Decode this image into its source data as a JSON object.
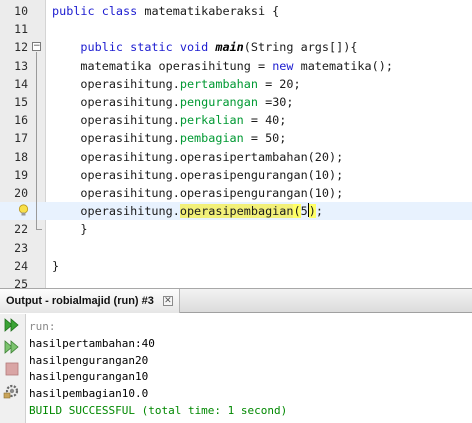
{
  "editor": {
    "lines": [
      {
        "num": "10",
        "tokens": [
          {
            "t": "public class ",
            "c": "kw"
          },
          {
            "t": "matematikaberaksi {",
            "c": ""
          }
        ]
      },
      {
        "num": "11",
        "tokens": []
      },
      {
        "num": "12",
        "tokens": [
          {
            "t": "    public static void ",
            "c": "kw"
          },
          {
            "t": "main",
            "c": "mth"
          },
          {
            "t": "(String args[]){",
            "c": ""
          }
        ]
      },
      {
        "num": "13",
        "tokens": [
          {
            "t": "    matematika operasihitung = ",
            "c": ""
          },
          {
            "t": "new",
            "c": "kw"
          },
          {
            "t": " matematika();",
            "c": ""
          }
        ]
      },
      {
        "num": "14",
        "tokens": [
          {
            "t": "    operasihitung.",
            "c": ""
          },
          {
            "t": "pertambahan",
            "c": "fld"
          },
          {
            "t": " = 20;",
            "c": ""
          }
        ]
      },
      {
        "num": "15",
        "tokens": [
          {
            "t": "    operasihitung.",
            "c": ""
          },
          {
            "t": "pengurangan",
            "c": "fld"
          },
          {
            "t": " =30;",
            "c": ""
          }
        ]
      },
      {
        "num": "16",
        "tokens": [
          {
            "t": "    operasihitung.",
            "c": ""
          },
          {
            "t": "perkalian",
            "c": "fld"
          },
          {
            "t": " = 40;",
            "c": ""
          }
        ]
      },
      {
        "num": "17",
        "tokens": [
          {
            "t": "    operasihitung.",
            "c": ""
          },
          {
            "t": "pembagian",
            "c": "fld"
          },
          {
            "t": " = 50;",
            "c": ""
          }
        ]
      },
      {
        "num": "18",
        "tokens": [
          {
            "t": "    operasihitung.operasipertambahan(20);",
            "c": ""
          }
        ]
      },
      {
        "num": "19",
        "tokens": [
          {
            "t": "    operasihitung.operasipengurangan(10);",
            "c": ""
          }
        ]
      },
      {
        "num": "20",
        "tokens": [
          {
            "t": "    operasihitung.operasipengurangan(10);",
            "c": ""
          }
        ]
      },
      {
        "num": "",
        "highlight": true,
        "tokens": [
          {
            "t": "    operasihitung.",
            "c": ""
          },
          {
            "t": "operasipembagian",
            "c": "hlw"
          },
          {
            "t": "(",
            "c": "brk"
          },
          {
            "t": "5",
            "c": ""
          },
          {
            "t": "cursor",
            "c": "cursor"
          },
          {
            "t": ")",
            "c": "brk"
          },
          {
            "t": ";",
            "c": ""
          }
        ]
      },
      {
        "num": "22",
        "tokens": [
          {
            "t": "    }",
            "c": ""
          }
        ]
      },
      {
        "num": "23",
        "tokens": []
      },
      {
        "num": "24",
        "tokens": [
          {
            "t": "}",
            "c": ""
          }
        ]
      },
      {
        "num": "25",
        "tokens": []
      }
    ]
  },
  "output": {
    "tab_title": "Output - robialmajid (run) #3",
    "close_label": "✕",
    "lines": [
      {
        "text": "run:",
        "style": "gray"
      },
      {
        "text": "hasilpertambahan:40",
        "style": ""
      },
      {
        "text": "hasilpengurangan20",
        "style": ""
      },
      {
        "text": "hasilpengurangan10",
        "style": ""
      },
      {
        "text": "hasilpembagian10.0",
        "style": ""
      },
      {
        "text": "BUILD SUCCESSFUL (total time: 1 second)",
        "style": "green"
      }
    ],
    "toolbar": [
      "rerun-icon",
      "rerun-with-options-icon",
      "stop-icon",
      "settings-icon"
    ]
  },
  "colors": {
    "keyword": "#1c1cd0",
    "field": "#009933",
    "current_line": "#e8f2fe",
    "occurrence_highlight": "#f2f079",
    "bracket_match": "#ffff66",
    "build_success": "#008800"
  }
}
